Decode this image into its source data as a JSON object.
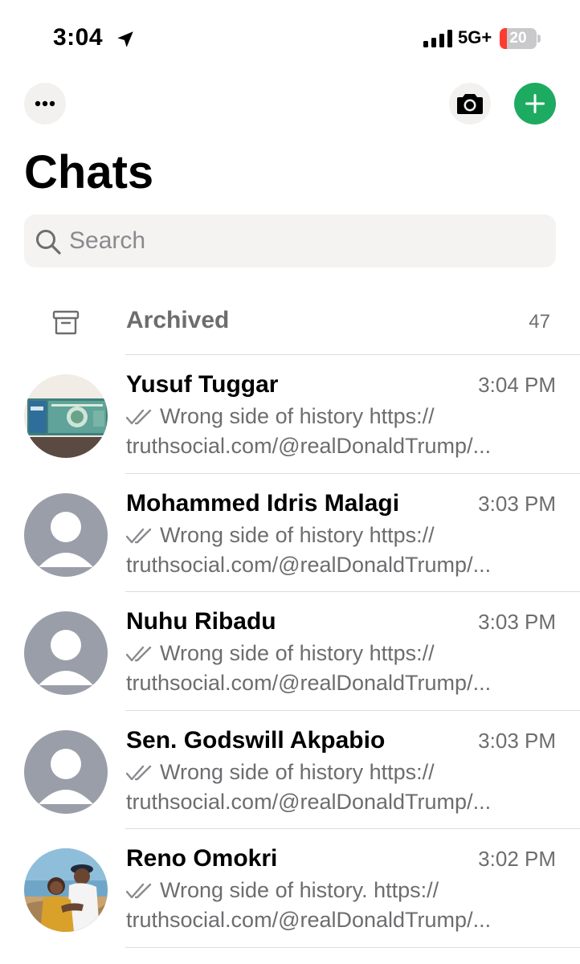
{
  "status_bar": {
    "time": "3:04",
    "network": "5G+",
    "battery": "20",
    "battery_level": 0.2
  },
  "header": {
    "more_icon": "ellipsis-icon",
    "camera_icon": "camera-icon",
    "new_chat_icon": "plus-icon",
    "title": "Chats",
    "accent_color": "#1dab61"
  },
  "search": {
    "placeholder": "Search",
    "value": ""
  },
  "archived": {
    "label": "Archived",
    "count": "47"
  },
  "chats": [
    {
      "name": "Yusuf Tuggar",
      "time": "3:04 PM",
      "preview_line1": "Wrong side of history  https://",
      "preview_line2": "truthsocial.com/@realDonaldTrump/...",
      "avatar": "photo"
    },
    {
      "name": "Mohammed Idris Malagi",
      "time": "3:03 PM",
      "preview_line1": "Wrong side of history  https://",
      "preview_line2": "truthsocial.com/@realDonaldTrump/...",
      "avatar": "default"
    },
    {
      "name": "Nuhu Ribadu",
      "time": "3:03 PM",
      "preview_line1": "Wrong side of history https://",
      "preview_line2": "truthsocial.com/@realDonaldTrump/...",
      "avatar": "default"
    },
    {
      "name": "Sen. Godswill Akpabio",
      "time": "3:03 PM",
      "preview_line1": "Wrong side of history https://",
      "preview_line2": "truthsocial.com/@realDonaldTrump/...",
      "avatar": "default"
    },
    {
      "name": "Reno Omokri",
      "time": "3:02 PM",
      "preview_line1": "Wrong side of history. https://",
      "preview_line2": "truthsocial.com/@realDonaldTrump/...",
      "avatar": "photo"
    }
  ]
}
